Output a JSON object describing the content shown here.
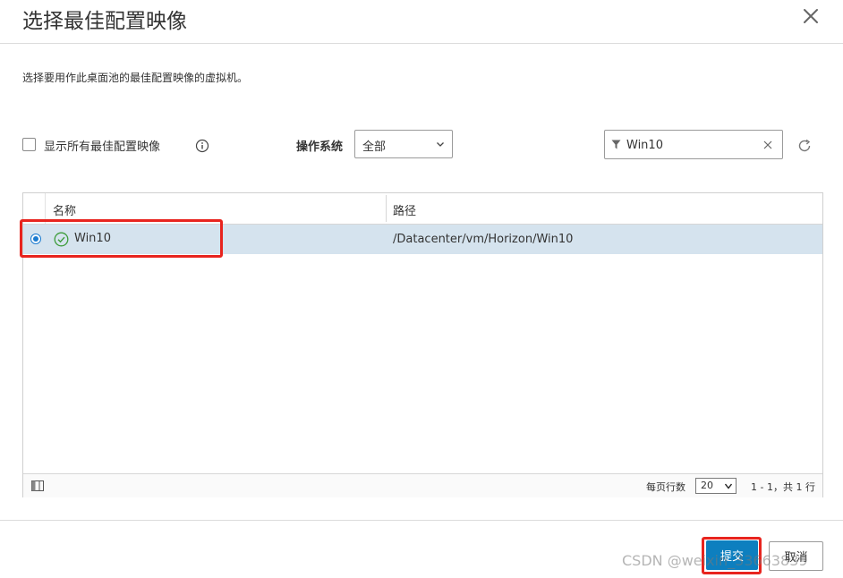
{
  "dialog": {
    "title": "选择最佳配置映像",
    "description": "选择要用作此桌面池的最佳配置映像的虚拟机。",
    "close_icon": "close-icon"
  },
  "toolbar": {
    "show_all_label": "显示所有最佳配置映像",
    "show_all_checked": false,
    "info_icon": "info-icon",
    "os_label": "操作系统",
    "os_selected": "全部",
    "filter_icon": "filter-icon",
    "filter_value": "Win10",
    "clear_icon": "clear-icon",
    "refresh_icon": "refresh-icon"
  },
  "grid": {
    "columns": [
      "名称",
      "路径"
    ],
    "rows": [
      {
        "name": "Win10",
        "path": "/Datacenter/vm/Horizon/Win10",
        "selected": true,
        "status_icon": "check-circle-icon"
      }
    ],
    "footer": {
      "column_toggle_icon": "columns-icon",
      "per_page_label": "每页行数",
      "per_page_value": "20",
      "pager_info": "1 - 1，共 1 行"
    }
  },
  "actions": {
    "submit_label": "提交",
    "cancel_label": "取消"
  },
  "watermark": "CSDN @weixin_33663839",
  "colors": {
    "accent": "#0d7fbf",
    "selected_row": "#d5e3ee",
    "success": "#3d9c3a",
    "annotation": "#e8241e"
  }
}
